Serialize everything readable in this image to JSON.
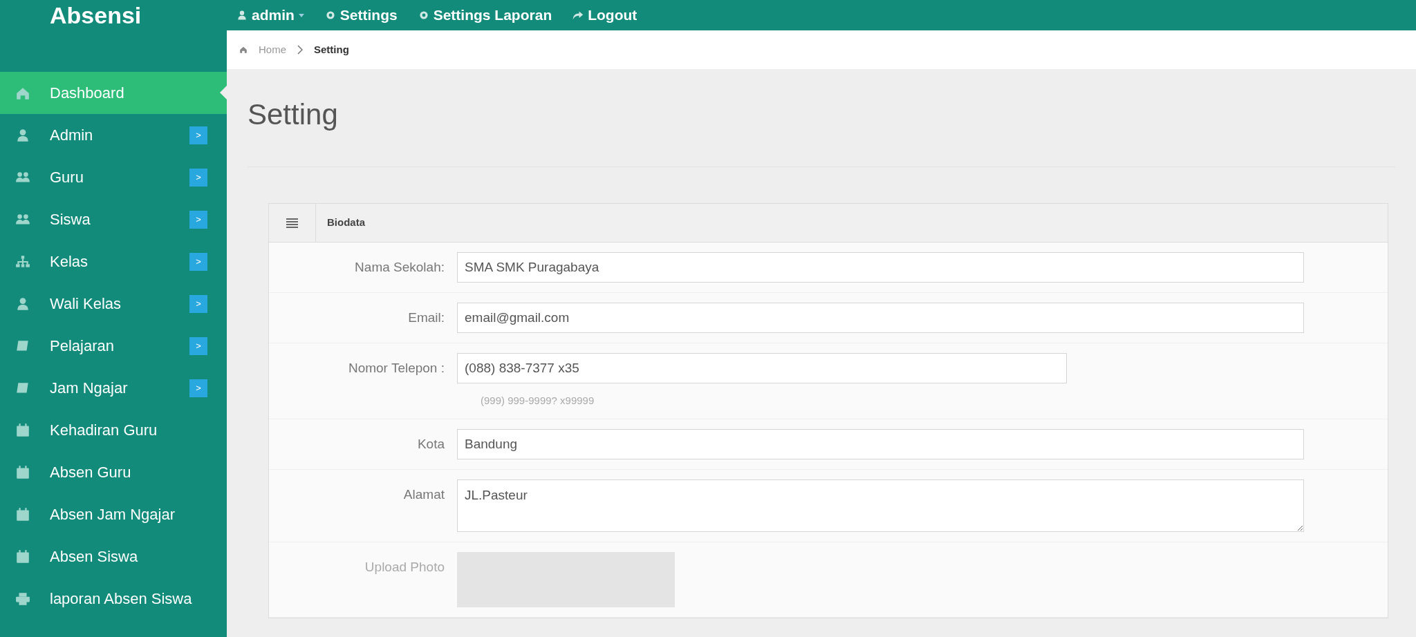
{
  "app_title": "Absensi",
  "topbar": [
    {
      "label": "admin",
      "kind": "user"
    },
    {
      "label": "Settings",
      "kind": "gear"
    },
    {
      "label": "Settings Laporan",
      "kind": "gear"
    },
    {
      "label": "Logout",
      "kind": "share"
    }
  ],
  "breadcrumb": [
    {
      "label": "Home",
      "current": false
    },
    {
      "label": "Setting",
      "current": true
    }
  ],
  "sidebar": {
    "items": [
      {
        "label": "Dashboard",
        "kind": "home",
        "selected": true,
        "submenu": false
      },
      {
        "label": "Admin",
        "kind": "user",
        "selected": false,
        "submenu": true
      },
      {
        "label": "Guru",
        "kind": "group",
        "selected": false,
        "submenu": true
      },
      {
        "label": "Siswa",
        "kind": "group",
        "selected": false,
        "submenu": true
      },
      {
        "label": "Kelas",
        "kind": "sitemap",
        "selected": false,
        "submenu": true
      },
      {
        "label": "Wali Kelas",
        "kind": "user",
        "selected": false,
        "submenu": true
      },
      {
        "label": "Pelajaran",
        "kind": "book",
        "selected": false,
        "submenu": true
      },
      {
        "label": "Jam Ngajar",
        "kind": "book",
        "selected": false,
        "submenu": true
      },
      {
        "label": "Kehadiran Guru",
        "kind": "calendar",
        "selected": false,
        "submenu": false
      },
      {
        "label": "Absen Guru",
        "kind": "calendar",
        "selected": false,
        "submenu": false
      },
      {
        "label": "Absen Jam Ngajar",
        "kind": "calendar",
        "selected": false,
        "submenu": false
      },
      {
        "label": "Absen Siswa",
        "kind": "calendar",
        "selected": false,
        "submenu": false
      },
      {
        "label": "laporan Absen Siswa",
        "kind": "print",
        "selected": false,
        "submenu": false
      }
    ],
    "submenu_marker": ">"
  },
  "page_title": "Setting",
  "panel": {
    "title": "Biodata",
    "fields": [
      {
        "label": "Nama Sekolah:",
        "kind": "input",
        "value": "SMA SMK Puragabaya"
      },
      {
        "label": "Email:",
        "kind": "input",
        "value": "email@gmail.com"
      },
      {
        "label": "Nomor Telepon :",
        "kind": "short",
        "value": "(088) 838-7377 x35",
        "hint": "(999) 999-9999? x99999"
      },
      {
        "label": "Kota",
        "kind": "input",
        "value": "Bandung"
      },
      {
        "label": "Alamat",
        "kind": "textarea",
        "value": "JL.Pasteur"
      },
      {
        "label": "Upload Photo",
        "kind": "photo"
      }
    ]
  }
}
